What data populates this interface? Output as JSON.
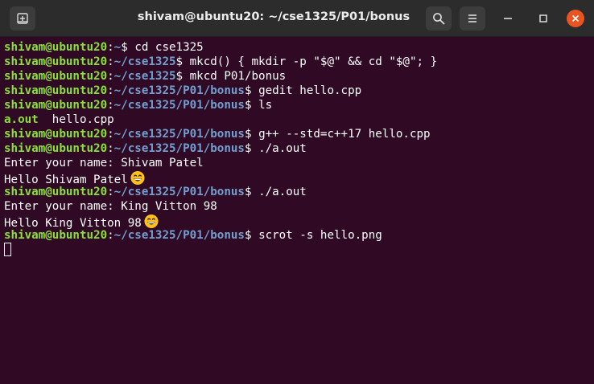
{
  "window": {
    "title": "shivam@ubuntu20: ~/cse1325/P01/bonus"
  },
  "prompt": {
    "user_host": "shivam@ubuntu20",
    "colon": ":",
    "dollar": "$ "
  },
  "lines": [
    {
      "path": "~",
      "cmd": "cd cse1325"
    },
    {
      "path": "~/cse1325",
      "cmd": "mkcd() { mkdir -p \"$@\" && cd \"$@\"; }"
    },
    {
      "path": "~/cse1325",
      "cmd": "mkcd P01/bonus"
    },
    {
      "path": "~/cse1325/P01/bonus",
      "cmd": "gedit hello.cpp"
    },
    {
      "path": "~/cse1325/P01/bonus",
      "cmd": "ls"
    },
    {
      "output_exe": "a.out",
      "output_rest": "  hello.cpp"
    },
    {
      "path": "~/cse1325/P01/bonus",
      "cmd": "g++ --std=c++17 hello.cpp"
    },
    {
      "path": "~/cse1325/P01/bonus",
      "cmd": "./a.out"
    },
    {
      "output": "Enter your name: Shivam Patel"
    },
    {
      "output": "Hello Shivam Patel",
      "emoji": "grinning-face-icon"
    },
    {
      "path": "~/cse1325/P01/bonus",
      "cmd": "./a.out"
    },
    {
      "output": "Enter your name: King Vitton 98"
    },
    {
      "output": "Hello King Vitton 98",
      "emoji": "grinning-face-icon"
    },
    {
      "path": "~/cse1325/P01/bonus",
      "cmd": "scrot -s hello.png"
    }
  ],
  "colors": {
    "background": "#300a24",
    "user_host": "#8ae234",
    "path": "#729fcf",
    "close_button": "#e95420"
  }
}
